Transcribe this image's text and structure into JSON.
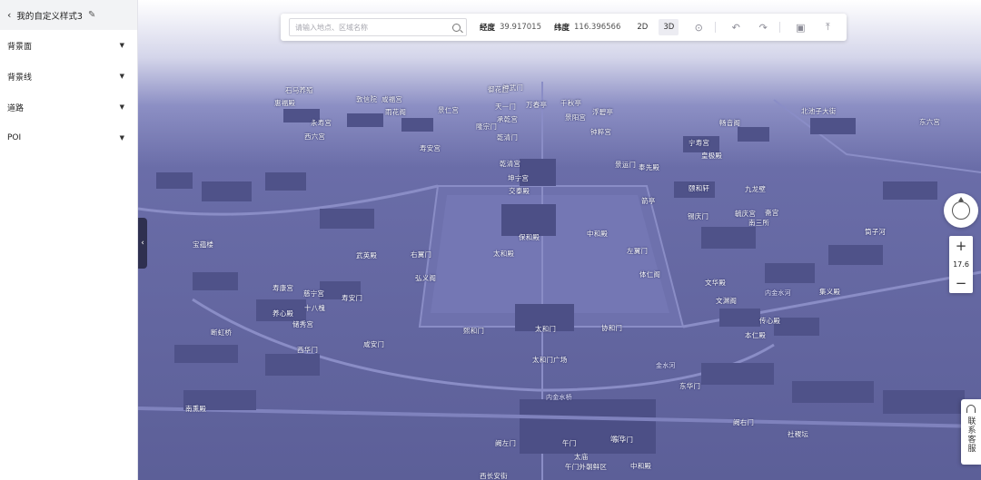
{
  "sidebar": {
    "title": "我的自定义样式3",
    "items": [
      {
        "label": "背景面"
      },
      {
        "label": "背景线"
      },
      {
        "label": "道路"
      },
      {
        "label": "POI"
      }
    ]
  },
  "toolbar": {
    "search_placeholder": "请输入地点、区域名称",
    "longitude_label": "经度",
    "longitude_value": "39.917015",
    "latitude_label": "纬度",
    "latitude_value": "116.396566",
    "btn_2d": "2D",
    "btn_3d": "3D"
  },
  "zoom": {
    "level": "17.6"
  },
  "contact": {
    "label": "联系客服"
  },
  "map_labels": [
    "石马养殖",
    "惠福殿",
    "敦信院",
    "咸福宫",
    "永寿宫",
    "景仁宫",
    "景阳宫",
    "寿安宫",
    "承乾宫",
    "钟粹宫",
    "天一门",
    "万春亭",
    "千秋亭",
    "浮碧亭",
    "御花园",
    "乾清宫",
    "乾清门",
    "坤宁宫",
    "交泰殿",
    "保和殿",
    "中和殿",
    "太和殿",
    "太和门",
    "协和门",
    "熙和门",
    "午门",
    "端门",
    "午门外朝鲜区",
    "右翼门",
    "左翼门",
    "体仁阁",
    "弘义阁",
    "文华殿",
    "武英殿",
    "内金水河",
    "慈宁宫",
    "寿康宫",
    "寿安门",
    "养心殿",
    "储秀宫",
    "宁寿宫",
    "皇极殿",
    "畅音阁",
    "颐和轩",
    "九龙壁",
    "锡庆门",
    "箭亭",
    "奉先殿",
    "斋宫",
    "毓庆宫",
    "南熏殿",
    "西华门",
    "东华门",
    "神武门",
    "隆宗门",
    "景运门",
    "文渊阁",
    "传心殿",
    "本仁殿",
    "集义殿",
    "内金水桥",
    "太和门广场",
    "中和殿",
    "宝蕴楼",
    "咸安门",
    "断虹桥",
    "十八槐",
    "南三所",
    "金水河",
    "东华门",
    "西长安街",
    "阙左门",
    "阙右门",
    "社稷坛",
    "太庙",
    "筒子河",
    "北池子大街",
    "东六宫",
    "西六宫",
    "雨花阁"
  ]
}
